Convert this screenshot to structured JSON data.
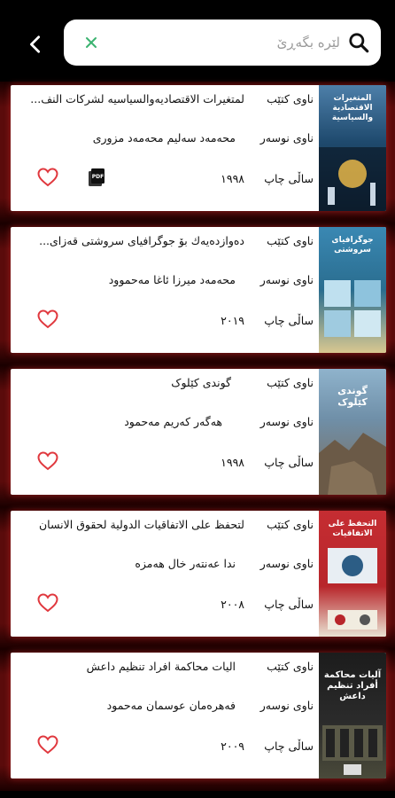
{
  "search": {
    "placeholder": "لێرە بگەڕێ",
    "value": ""
  },
  "labels": {
    "title": "ناوی کتێب",
    "author": "ناوی نوسەر",
    "year": "ساڵی چاپ"
  },
  "books": [
    {
      "title": "لمتغيرات الاقتصاديه‌والسياسيه لشركات النف...",
      "author": "محەمەد سەلیم محەمەد مزوری",
      "year": "١٩٩٨",
      "has_pdf": true,
      "cover_color": "#14324f",
      "cover_text": "المتغيرات الاقتصادية والسياسية"
    },
    {
      "title": "دەوازدەیەك بۆ جوگرافیای سروشتی قەزای...",
      "author": "محەمەد میرزا ئاغا مەحموود",
      "year": "٢٠١٩",
      "has_pdf": false,
      "cover_color": "#2a6d8f",
      "cover_text": "جوگرافیای سروشتی"
    },
    {
      "title": "گوندی کێلوک",
      "author": "هەگەر کەریم مەحمود",
      "year": "١٩٩٨",
      "has_pdf": false,
      "cover_color": "#6f8fa8",
      "cover_text": "گوندی کێلوک"
    },
    {
      "title": "لتحفظ على الاتفاقيات الدولية لحقوق الانسان",
      "author": "ندا عەنتەر خال هەمزە",
      "year": "٢٠٠٨",
      "has_pdf": false,
      "cover_color": "#b8262b",
      "cover_text": "التحفظ على الاتفاقيات"
    },
    {
      "title": "اليات محاكمة افراد تنظيم داعش",
      "author": "فەهرەمان عوسمان مەحمود",
      "year": "٢٠٠٩",
      "has_pdf": false,
      "cover_color": "#2b2b2b",
      "cover_text": "آليات محاكمة أفراد تنظيم داعش"
    }
  ],
  "colors": {
    "accent": "#e0383e",
    "clear": "#3cb371",
    "glow": "#5a0b0b"
  },
  "icons": {
    "back": "chevron-left-icon",
    "search": "search-icon",
    "clear": "close-icon",
    "favorite": "heart-outline-icon",
    "pdf": "pdf-icon"
  }
}
